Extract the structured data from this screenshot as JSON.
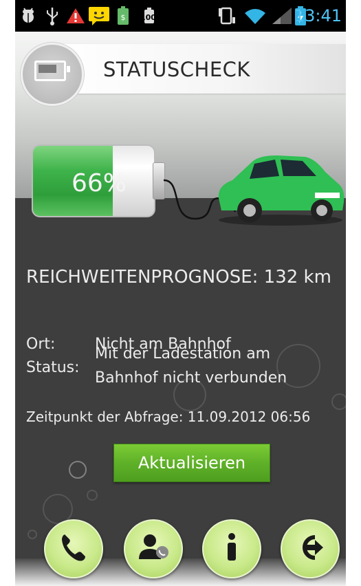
{
  "status_bar": {
    "time": "13:41",
    "icons": [
      "android-debug-icon",
      "usb-icon",
      "warning-icon",
      "message-icon",
      "battery-saver-icon",
      "battery-100-icon",
      "vibrate-icon",
      "wifi-icon",
      "signal-icon",
      "battery-charging-icon"
    ],
    "battery_icon_label": "100"
  },
  "header": {
    "title": "STATUSCHECK",
    "icon": "battery-icon"
  },
  "battery": {
    "percent_label": "66%",
    "level": 0.66
  },
  "range": {
    "text": "REICHWEITENPROGNOSE: 132 km"
  },
  "info": {
    "ort_label": "Ort:",
    "ort_value": "Nicht am Bahnhof",
    "status_label": "Status:",
    "status_line1": "Mit der Ladestation am",
    "status_line2": "Bahnhof nicht verbunden",
    "timestamp": "Zeitpunkt der Abfrage: 11.09.2012 06:56"
  },
  "update_button": {
    "label": "Aktualisieren"
  },
  "bottom_nav": {
    "buttons": [
      "phone-icon",
      "contact-icon",
      "info-icon",
      "exit-icon"
    ]
  },
  "colors": {
    "accent_green": "#5fb128",
    "time_blue": "#4fc3f7",
    "background_dark": "#3e3e3e"
  }
}
